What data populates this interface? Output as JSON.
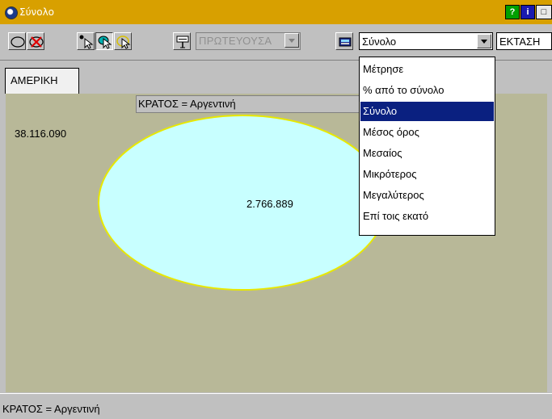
{
  "window": {
    "title": "Σύνολο"
  },
  "title_buttons": {
    "help": "?",
    "info": "i",
    "maximize": "□"
  },
  "toolbar": {
    "capital_select": "ΠΡΩΤΕΥΟΥΣΑ",
    "statistic_select": "Σύνολο",
    "field_select": "ΕΚΤΑΣΗ"
  },
  "tabs": [
    {
      "label": "ΑΜΕΡΙΚΗ"
    }
  ],
  "map": {
    "state_label": "ΚΡΑΤΟΣ = Αργεντινή",
    "total_value": "38.116.090",
    "region_value": "2.766.889"
  },
  "statistic_options": [
    "Μέτρησε",
    "% από το σύνολο",
    "Σύνολο",
    "Μέσος όρος",
    "Μεσαίος",
    "Μικρότερος",
    "Μεγαλύτερος",
    "Επί τοις εκατό"
  ],
  "selected_option": "Σύνολο",
  "status": {
    "text": "ΚΡΑΤΟΣ = Αργεντινή"
  },
  "colors": {
    "titlebar": "#d8a000",
    "map_background": "#b8b898",
    "region_fill": "#c8ffff",
    "region_outline": "#e8e800",
    "selection": "#0a2080"
  }
}
